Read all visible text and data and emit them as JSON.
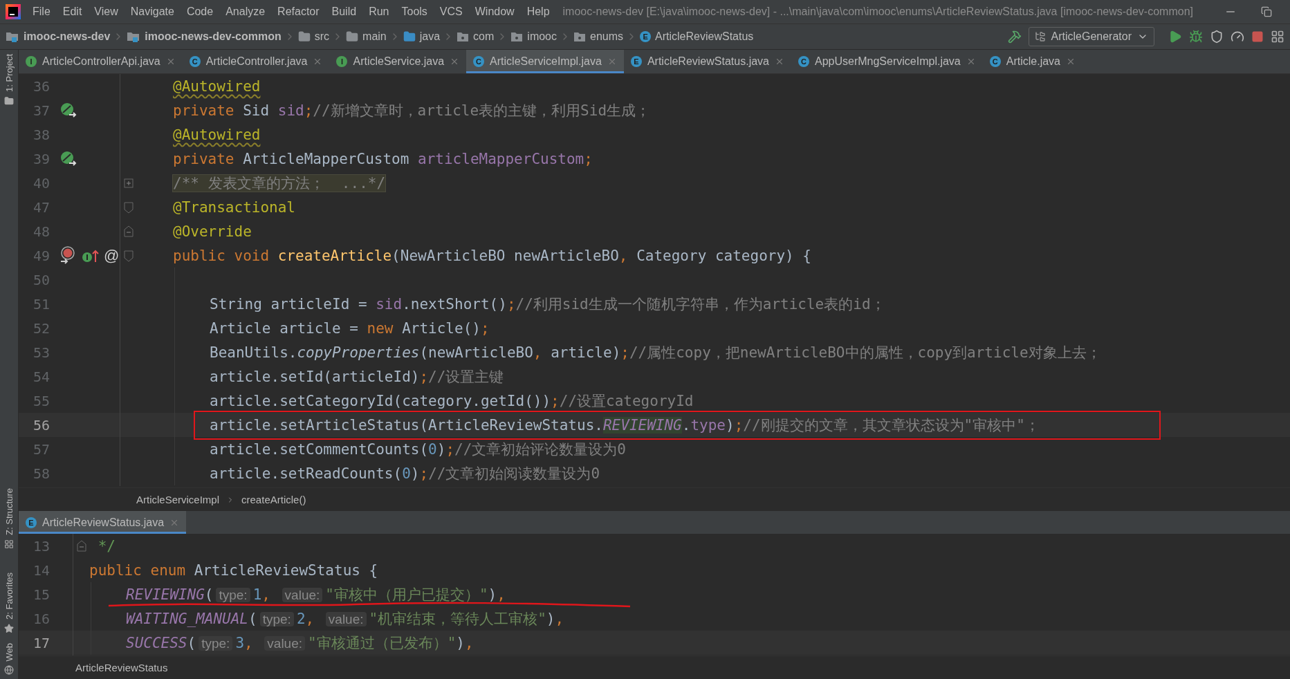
{
  "menu": [
    "File",
    "Edit",
    "View",
    "Navigate",
    "Code",
    "Analyze",
    "Refactor",
    "Build",
    "Run",
    "Tools",
    "VCS",
    "Window",
    "Help"
  ],
  "window": {
    "title": "imooc-news-dev [E:\\java\\imooc-news-dev] - ...\\main\\java\\com\\imooc\\enums\\ArticleReviewStatus.java [imooc-news-dev-common]"
  },
  "nav": [
    {
      "kind": "module",
      "label": "imooc-news-dev"
    },
    {
      "kind": "module",
      "label": "imooc-news-dev-common"
    },
    {
      "kind": "folder",
      "label": "src"
    },
    {
      "kind": "folder",
      "label": "main"
    },
    {
      "kind": "source",
      "label": "java"
    },
    {
      "kind": "package",
      "label": "com"
    },
    {
      "kind": "package",
      "label": "imooc"
    },
    {
      "kind": "package",
      "label": "enums"
    },
    {
      "kind": "class",
      "label": "ArticleReviewStatus",
      "badge": "E",
      "color": "#3592c4"
    }
  ],
  "run_config": "ArticleGenerator",
  "side_tools": [
    {
      "label": "1: Project",
      "kind": "folder"
    },
    {
      "label": "Z: Structure",
      "kind": "structure"
    },
    {
      "label": "2: Favorites",
      "kind": "star"
    },
    {
      "label": "Web",
      "kind": "globe"
    }
  ],
  "tabs": [
    {
      "label": "ArticleControllerApi.java",
      "badge": "I",
      "color": "#499c54",
      "selected": false
    },
    {
      "label": "ArticleController.java",
      "badge": "C",
      "color": "#3592c4",
      "selected": false
    },
    {
      "label": "ArticleService.java",
      "badge": "I",
      "color": "#499c54",
      "selected": false
    },
    {
      "label": "ArticleServiceImpl.java",
      "badge": "C",
      "color": "#3592c4",
      "selected": true
    },
    {
      "label": "ArticleReviewStatus.java",
      "badge": "E",
      "color": "#3592c4",
      "selected": false
    },
    {
      "label": "AppUserMngServiceImpl.java",
      "badge": "C",
      "color": "#3592c4",
      "selected": false
    },
    {
      "label": "Article.java",
      "badge": "C",
      "color": "#3592c4",
      "selected": false
    }
  ],
  "editor": {
    "lines": [
      {
        "number": "36",
        "kind": "member",
        "current": false,
        "tokens": [
          {
            "kind": "ann_warn",
            "t": "@Autowired"
          }
        ]
      },
      {
        "number": "37",
        "kind": "member",
        "current": false,
        "gutter": [
          {
            "kind": "bean"
          }
        ],
        "tokens": [
          {
            "kind": "kw",
            "t": "private "
          },
          {
            "kind": "plain",
            "t": "Sid "
          },
          {
            "kind": "field",
            "t": "sid"
          },
          {
            "kind": "kw",
            "t": ";"
          },
          {
            "kind": "comment",
            "t": "//新增文章时，article表的主键，利用Sid生成；"
          }
        ]
      },
      {
        "number": "38",
        "kind": "member",
        "current": false,
        "tokens": [
          {
            "kind": "ann_warn",
            "t": "@Autowired"
          }
        ]
      },
      {
        "number": "39",
        "kind": "member",
        "current": false,
        "gutter": [
          {
            "kind": "bean"
          }
        ],
        "tokens": [
          {
            "kind": "kw",
            "t": "private "
          },
          {
            "kind": "plain",
            "t": "ArticleMapperCustom "
          },
          {
            "kind": "field",
            "t": "articleMapperCustom"
          },
          {
            "kind": "kw",
            "t": ";"
          }
        ]
      },
      {
        "number": "40",
        "kind": "member",
        "current": false,
        "fold": {
          "kind": "plus"
        },
        "tokens": [
          {
            "kind": "folded",
            "t": "/** 发表文章的方法；  ...*/"
          }
        ]
      },
      {
        "number": "47",
        "kind": "member",
        "current": false,
        "fold": {
          "kind": "start"
        },
        "tokens": [
          {
            "kind": "ann",
            "t": "@Transactional"
          }
        ]
      },
      {
        "number": "48",
        "kind": "member",
        "current": false,
        "fold": {
          "kind": "end"
        },
        "tokens": [
          {
            "kind": "ann",
            "t": "@Override"
          }
        ]
      },
      {
        "number": "49",
        "kind": "member",
        "current": false,
        "fold": {
          "kind": "start"
        },
        "gutter": [
          {
            "kind": "override"
          },
          {
            "kind": "implements"
          },
          {
            "kind": "symbol",
            "text": "@"
          }
        ],
        "tokens": [
          {
            "kind": "kw",
            "t": "public void "
          },
          {
            "kind": "method",
            "t": "createArticle"
          },
          {
            "kind": "plain",
            "t": "(NewArticleBO newArticleBO"
          },
          {
            "kind": "kw",
            "t": ", "
          },
          {
            "kind": "plain",
            "t": "Category category) {"
          }
        ]
      },
      {
        "number": "50",
        "kind": "body",
        "current": false
      },
      {
        "number": "51",
        "kind": "body",
        "current": false,
        "tokens": [
          {
            "kind": "plain",
            "t": "String articleId = "
          },
          {
            "kind": "field",
            "t": "sid"
          },
          {
            "kind": "plain",
            "t": ".nextShort()"
          },
          {
            "kind": "kw",
            "t": ";"
          },
          {
            "kind": "comment",
            "t": "//利用sid生成一个随机字符串，作为article表的id；"
          }
        ]
      },
      {
        "number": "52",
        "kind": "body",
        "current": false,
        "tokens": [
          {
            "kind": "plain",
            "t": "Article article = "
          },
          {
            "kind": "kw",
            "t": "new "
          },
          {
            "kind": "plain",
            "t": "Article()"
          },
          {
            "kind": "kw",
            "t": ";"
          }
        ]
      },
      {
        "number": "53",
        "kind": "body",
        "current": false,
        "tokens": [
          {
            "kind": "plain",
            "t": "BeanUtils."
          },
          {
            "kind": "static",
            "t": "copyProperties"
          },
          {
            "kind": "plain",
            "t": "(newArticleBO"
          },
          {
            "kind": "kw",
            "t": ", "
          },
          {
            "kind": "plain",
            "t": "article)"
          },
          {
            "kind": "kw",
            "t": ";"
          },
          {
            "kind": "comment",
            "t": "//属性copy，把newArticleBO中的属性，copy到article对象上去；"
          }
        ]
      },
      {
        "number": "54",
        "kind": "body",
        "current": false,
        "tokens": [
          {
            "kind": "plain",
            "t": "article.setId(articleId)"
          },
          {
            "kind": "kw",
            "t": ";"
          },
          {
            "kind": "comment",
            "t": "//设置主键"
          }
        ]
      },
      {
        "number": "55",
        "kind": "body",
        "current": false,
        "tokens": [
          {
            "kind": "plain",
            "t": "article.setCategoryId(category.getId())"
          },
          {
            "kind": "kw",
            "t": ";"
          },
          {
            "kind": "comment",
            "t": "//设置categoryId"
          }
        ]
      },
      {
        "number": "56",
        "kind": "body",
        "current": true,
        "tokens": [
          {
            "kind": "plain",
            "t": "article.setArticleStatus(ArticleReviewStatus."
          },
          {
            "kind": "const_hl",
            "t": "REVIEWING"
          },
          {
            "kind": "plain",
            "t": "."
          },
          {
            "kind": "field",
            "t": "type"
          },
          {
            "kind": "plain",
            "t": ")"
          },
          {
            "kind": "kw",
            "t": ";"
          },
          {
            "kind": "comment",
            "t": "//刚提交的文章，其文章状态设为\"审核中\"；"
          }
        ]
      },
      {
        "number": "57",
        "kind": "body",
        "current": false,
        "tokens": [
          {
            "kind": "plain",
            "t": "article.setCommentCounts("
          },
          {
            "kind": "num",
            "t": "0"
          },
          {
            "kind": "plain",
            "t": ")"
          },
          {
            "kind": "kw",
            "t": ";"
          },
          {
            "kind": "comment",
            "t": "//文章初始评论数量设为0"
          }
        ]
      },
      {
        "number": "58",
        "kind": "body",
        "current": false,
        "tokens": [
          {
            "kind": "plain",
            "t": "article.setReadCounts("
          },
          {
            "kind": "num",
            "t": "0"
          },
          {
            "kind": "plain",
            "t": ")"
          },
          {
            "kind": "kw",
            "t": ";"
          },
          {
            "kind": "comment",
            "t": "//文章初始阅读数量设为0"
          }
        ]
      }
    ],
    "breadcrumb": [
      "ArticleServiceImpl",
      "createArticle()"
    ]
  },
  "bottom_tab": {
    "label": "ArticleReviewStatus.java",
    "badge": "E",
    "color": "#3592c4",
    "selected": true
  },
  "bottom_editor": {
    "lines": [
      {
        "number": "13",
        "kind": "member",
        "current": false,
        "fold": {
          "kind": "end"
        },
        "tokens": [
          {
            "kind": "doc",
            "t": " */"
          }
        ]
      },
      {
        "number": "14",
        "kind": "member",
        "current": false,
        "tokens": [
          {
            "kind": "kw",
            "t": "public enum "
          },
          {
            "kind": "plain",
            "t": "ArticleReviewStatus {"
          }
        ]
      },
      {
        "number": "15",
        "kind": "body",
        "current": false,
        "tokens": [
          {
            "kind": "const",
            "t": "REVIEWING"
          },
          {
            "kind": "plain",
            "t": "("
          },
          {
            "kind": "hint",
            "t": "type:"
          },
          {
            "kind": "num",
            "t": "1"
          },
          {
            "kind": "kw",
            "t": ", "
          },
          {
            "kind": "hint",
            "t": "value:"
          },
          {
            "kind": "str",
            "t": "\"审核中（用户已提交）\""
          },
          {
            "kind": "plain",
            "t": ")"
          },
          {
            "kind": "kw",
            "t": ","
          }
        ]
      },
      {
        "number": "16",
        "kind": "body",
        "current": false,
        "tokens": [
          {
            "kind": "const",
            "t": "WAITING_MANUAL"
          },
          {
            "kind": "plain",
            "t": "("
          },
          {
            "kind": "hint",
            "t": "type:"
          },
          {
            "kind": "num",
            "t": "2"
          },
          {
            "kind": "kw",
            "t": ", "
          },
          {
            "kind": "hint",
            "t": "value:"
          },
          {
            "kind": "str",
            "t": "\"机审结束，等待人工审核\""
          },
          {
            "kind": "plain",
            "t": ")"
          },
          {
            "kind": "kw",
            "t": ","
          }
        ]
      },
      {
        "number": "17",
        "kind": "body",
        "current": true,
        "tokens": [
          {
            "kind": "const",
            "t": "SUCCESS"
          },
          {
            "kind": "plain",
            "t": "("
          },
          {
            "kind": "hint",
            "t": "type:"
          },
          {
            "kind": "num",
            "t": "3"
          },
          {
            "kind": "kw",
            "t": ", "
          },
          {
            "kind": "hint",
            "t": "value:"
          },
          {
            "kind": "str",
            "t": "\"审核通过（已发布）\""
          },
          {
            "kind": "plain",
            "t": ")"
          },
          {
            "kind": "kw",
            "t": ","
          }
        ]
      }
    ],
    "breadcrumb": [
      "ArticleReviewStatus"
    ]
  }
}
